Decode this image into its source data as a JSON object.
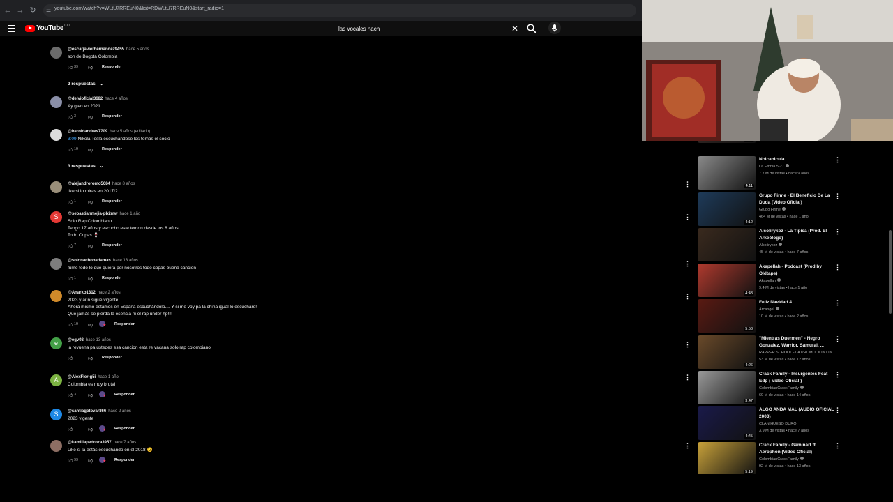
{
  "browser": {
    "url": "youtube.com/watch?v=WLtU7RREuN0&list=RDWLtU7RREuN0&start_radio=1",
    "icons": [
      "back-icon",
      "forward-icon",
      "reload-icon",
      "site-info-icon"
    ]
  },
  "header": {
    "logo_text": "YouTube",
    "logo_sup": "CO",
    "search_value": "las vocales nach"
  },
  "comments": [
    {
      "author": "@oscarjavierhernandez9455",
      "time": "hace 5 años",
      "text": "son de Bogotá Colombia",
      "likes": "39",
      "avatar": "img",
      "color": "#6b6b6b",
      "heart": false
    },
    {
      "author": "@deivioficial3682",
      "time": "hace 4 años",
      "text": "Ay gien en 2021",
      "likes": "3",
      "avatar": "img",
      "color": "#8a8fa8",
      "heart": false
    },
    {
      "author": "@haroldandres7709",
      "time": "hace 5 años (editado)",
      "timestamp": "3:09",
      "text": "Nikola Tesla escuchándose los temas el socio",
      "likes": "19",
      "avatar": "img",
      "color": "#dcdcdc",
      "heart": false
    },
    {
      "author": "@alejandroromo5684",
      "time": "hace 8 años",
      "text": "like si lo miras en 2017!?",
      "likes": "1",
      "avatar": "img",
      "color": "#9a8f7a",
      "heart": false
    },
    {
      "author": "@sebastianmejia-pb2mw",
      "time": "hace 1 año",
      "text": "Solo Rap Colombiano\nTengo 17 años y escucho este temon desde los 8 años\nTodo Copas 🍷",
      "likes": "7",
      "avatar": "S",
      "color": "#e53935",
      "heart": false
    },
    {
      "author": "@solonachonadamas",
      "time": "hace 13 años",
      "text": "fume todo lo que quiera por nosotros todo copas buena cancion",
      "likes": "1",
      "avatar": "img",
      "color": "#7d7d7d",
      "heart": false
    },
    {
      "author": "@Anarko1312",
      "time": "hace 2 años",
      "text": "2023 y aún sigue vigente.....\nAhora mismo estamos en España escuchándolo.... Y si me voy pa la china igual lo escuchare!\nQue jamás se pierda la esencia ni el rap under hp!!!",
      "likes": "19",
      "avatar": "img",
      "color": "#d08a2a",
      "heart": true
    },
    {
      "author": "@egv08",
      "time": "hace 13 años",
      "text": "la revuena pa ustedes esa cancion esta re vacana solo rap colombiano",
      "likes": "1",
      "avatar": "e",
      "color": "#43a047",
      "heart": false
    },
    {
      "author": "@AlexFler-g5i",
      "time": "hace 1 año",
      "text": "Colombia es muy brutal",
      "likes": "3",
      "avatar": "A",
      "color": "#7cb342",
      "heart": true
    },
    {
      "author": "@santiagotovar866",
      "time": "hace 2 años",
      "text": "2023 vigente",
      "likes": "1",
      "avatar": "S",
      "color": "#1e88e5",
      "heart": true
    },
    {
      "author": "@kamiilapedroza3957",
      "time": "hace 7 años",
      "text": "Like si la estás escuchando en el 2018 😉",
      "likes": "99",
      "avatar": "img",
      "color": "#8d6e63",
      "heart": true
    }
  ],
  "reply_label": "Responder",
  "replies_toggles": [
    "2 respuestas",
    "3 respuestas"
  ],
  "sidebar": [
    {
      "title": "",
      "channel": "",
      "meta": "",
      "duration": "4:59",
      "color": "#3a2e2a",
      "partial": true
    },
    {
      "title": "Noicanicula",
      "channel": "La Etnnia 5-27",
      "meta": "7.7 M de vistas • hace 9 años",
      "duration": "4:11",
      "color": "#8a8a8a",
      "verified": true
    },
    {
      "title": "Grupo Firme - El Beneficio De La Duda (Video Oficial)",
      "channel": "Grupo Firme",
      "meta": "464 M de vistas • hace 1 año",
      "duration": "4:12",
      "color": "#1e3b5a",
      "verified": true
    },
    {
      "title": "Alcolirykoz - La Típica (Prod. El Arkeólogo)",
      "channel": "Alcolirykoz",
      "meta": "45 M de vistas • hace 7 años",
      "duration": "",
      "color": "#3a2a1e",
      "verified": true
    },
    {
      "title": "Akapellah - Podcast (Prod by Oldtape)",
      "channel": "Akapellah",
      "meta": "9.4 M de vistas • hace 1 año",
      "duration": "4:43",
      "color": "#b03a2e",
      "verified": true
    },
    {
      "title": "Feliz Navidad 4",
      "channel": "Arcangel",
      "meta": "10 M de vistas • hace 2 años",
      "duration": "5:53",
      "color": "#5a1a12",
      "verified": true
    },
    {
      "title": "\"Mientras Duermen\" - Negro Gonzalez, Warrior, Samurai, ...",
      "channel": "RAPPER SCHOOL - LA PROMOCION LIN...",
      "meta": "53 M de vistas • hace 12 años",
      "duration": "4:26",
      "color": "#6a4a2a",
      "verified": false
    },
    {
      "title": "Crack Family - Insurgentes Feat Edp ( Video Oficial )",
      "channel": "ColombianCrackFamily",
      "meta": "60 M de vistas • hace 14 años",
      "duration": "3:47",
      "color": "#9a9a9a",
      "verified": true
    },
    {
      "title": "ALGO ANDA MAL (AUDIO OFICIAL 2003)",
      "channel": "CLAN HUESO DURO",
      "meta": "3.9 M de vistas • hace 7 años",
      "duration": "4:45",
      "color": "#1a1a4a",
      "verified": false
    },
    {
      "title": "Crack Family - Gaminart ft. Aerophon (Video Oficial)",
      "channel": "ColombianCrackFamily",
      "meta": "92 M de vistas • hace 13 años",
      "duration": "5:19",
      "color": "#c9a23a",
      "verified": true
    }
  ]
}
